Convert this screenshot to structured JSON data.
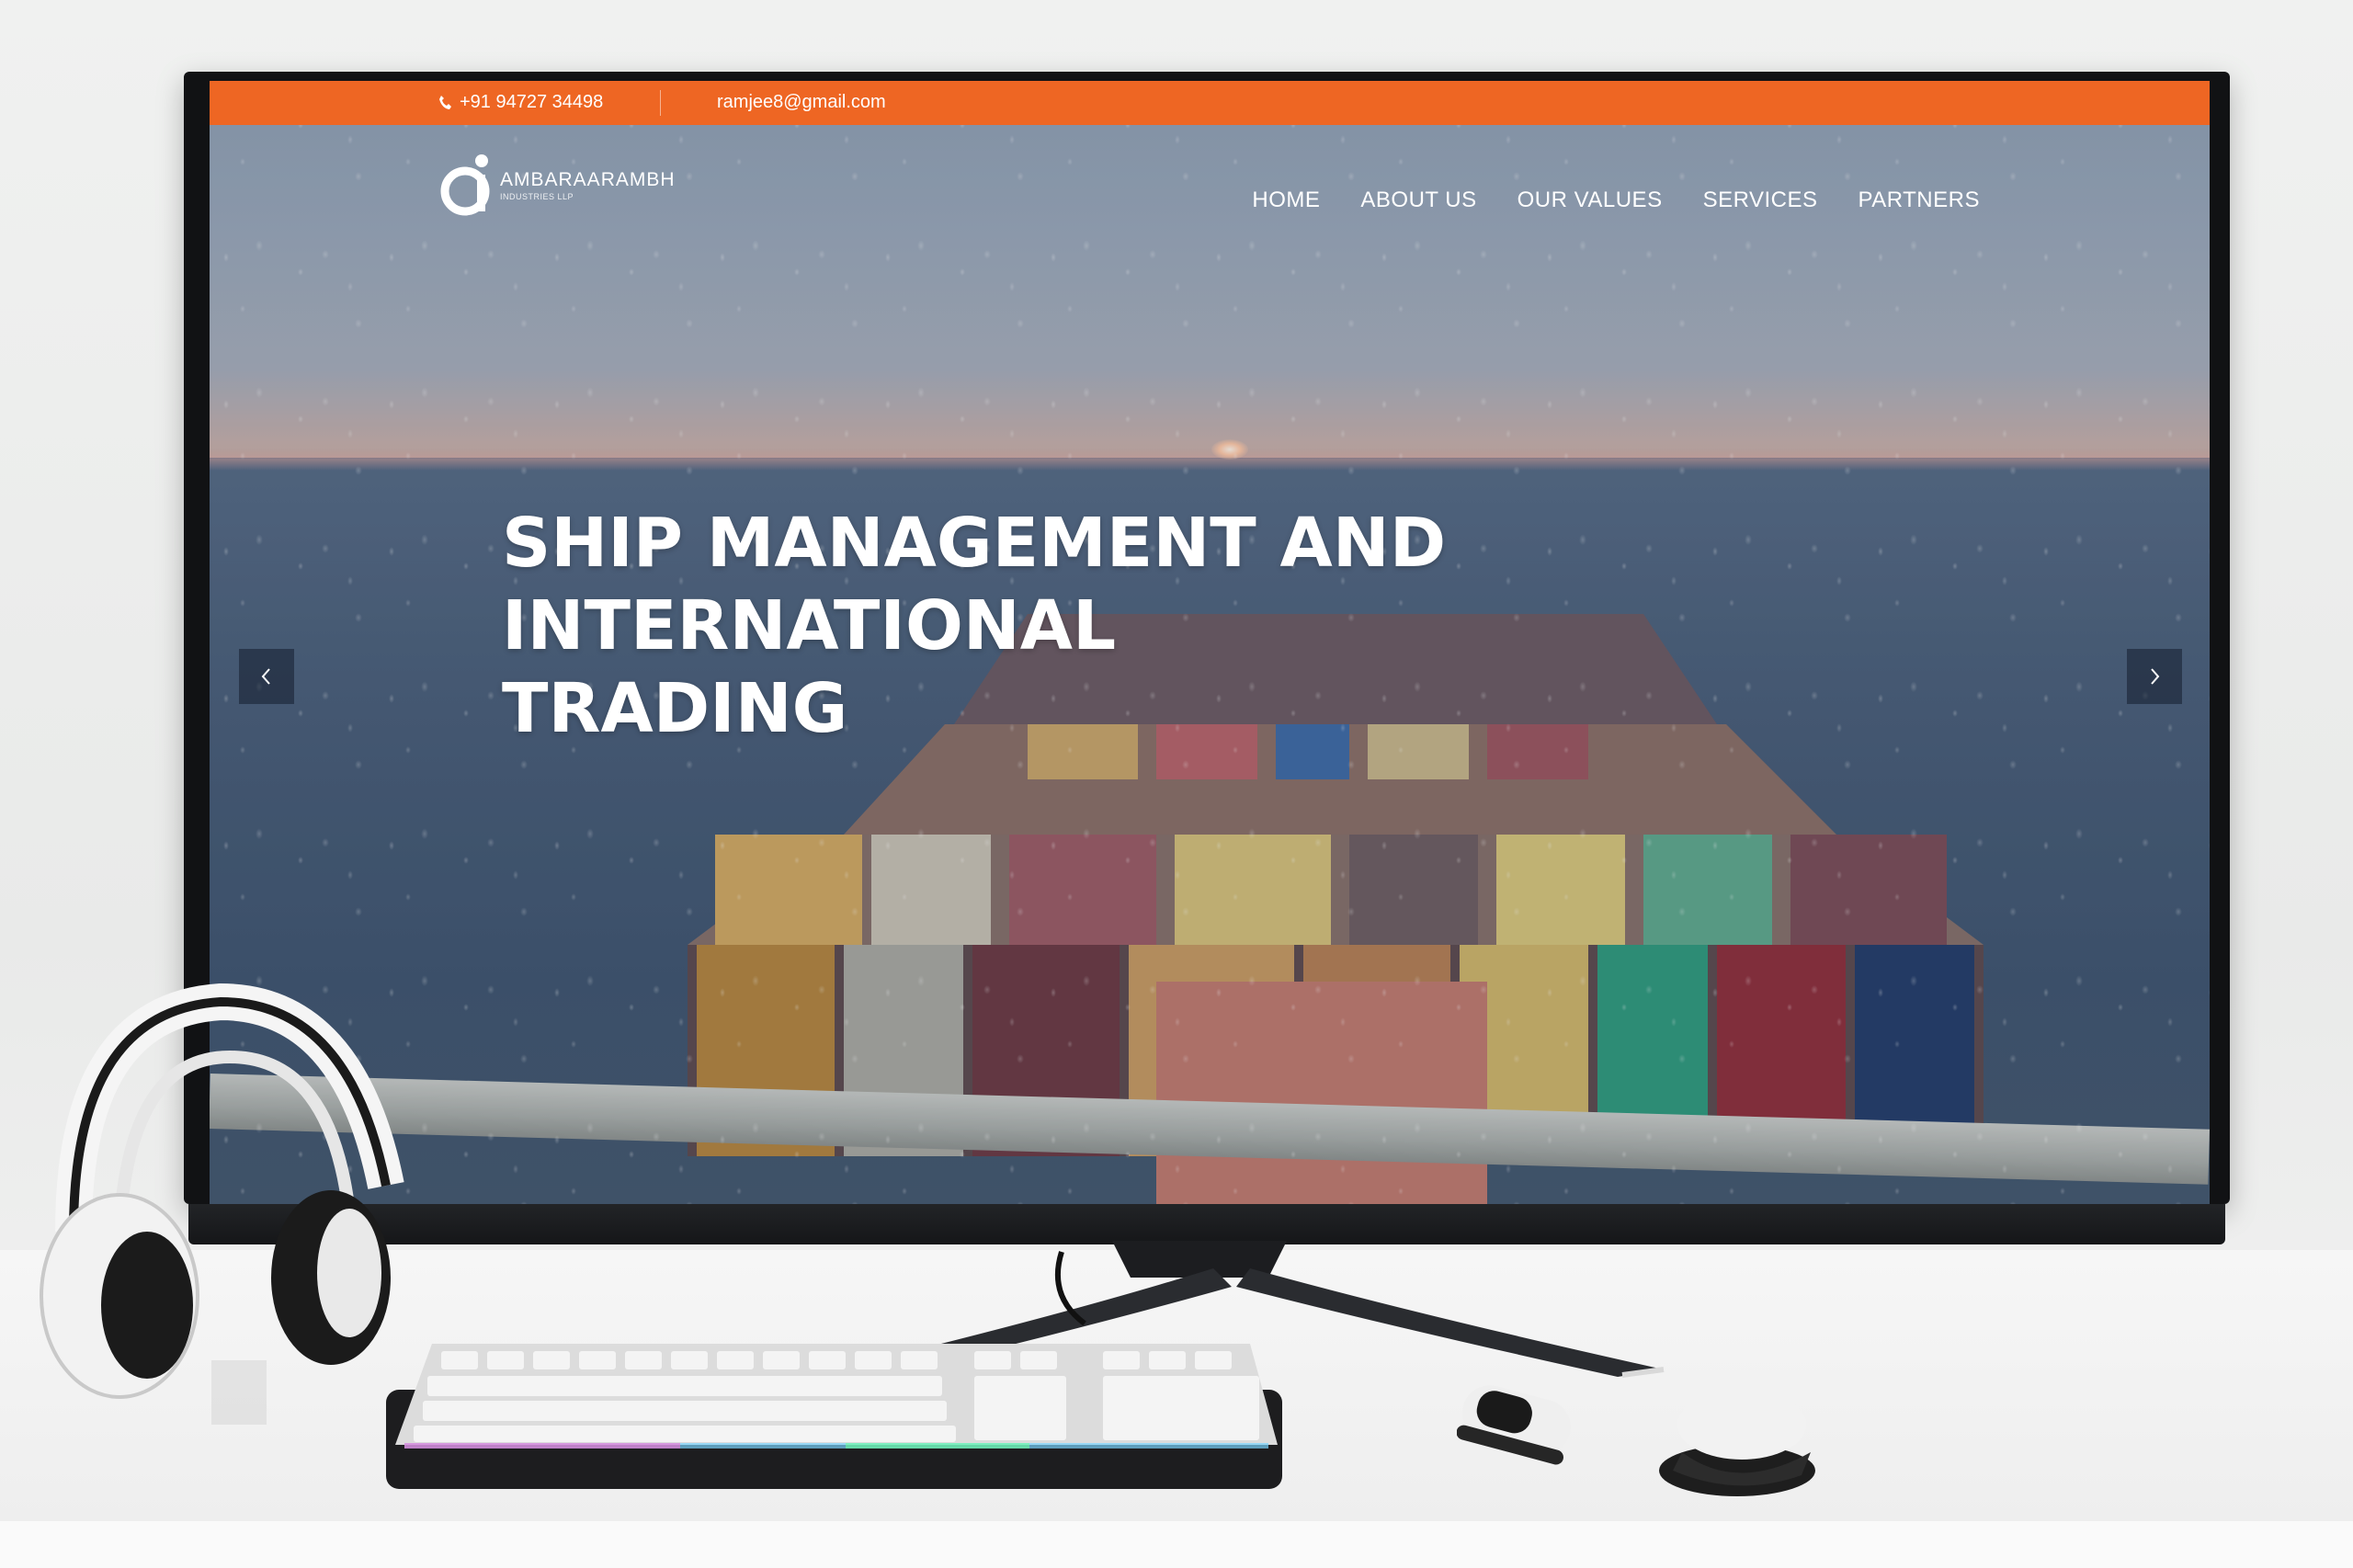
{
  "topbar": {
    "phone": "+91 94727 34498",
    "email": "ramjee8@gmail.com",
    "phone_icon": "phone-icon",
    "color": "#ee6623"
  },
  "brand": {
    "name": "AMBARAARAMBH",
    "subtitle": "INDUSTRIES LLP",
    "logo_icon": "brand-logo-icon"
  },
  "nav": {
    "items": [
      {
        "label": "HOME"
      },
      {
        "label": "ABOUT US"
      },
      {
        "label": "OUR VALUES"
      },
      {
        "label": "SERVICES"
      },
      {
        "label": "PARTNERS"
      }
    ]
  },
  "hero": {
    "lines": [
      "SHIP MANAGEMENT AND",
      "INTERNATIONAL",
      "TRADING"
    ],
    "prev_icon": "chevron-left-icon",
    "next_icon": "chevron-right-icon"
  }
}
